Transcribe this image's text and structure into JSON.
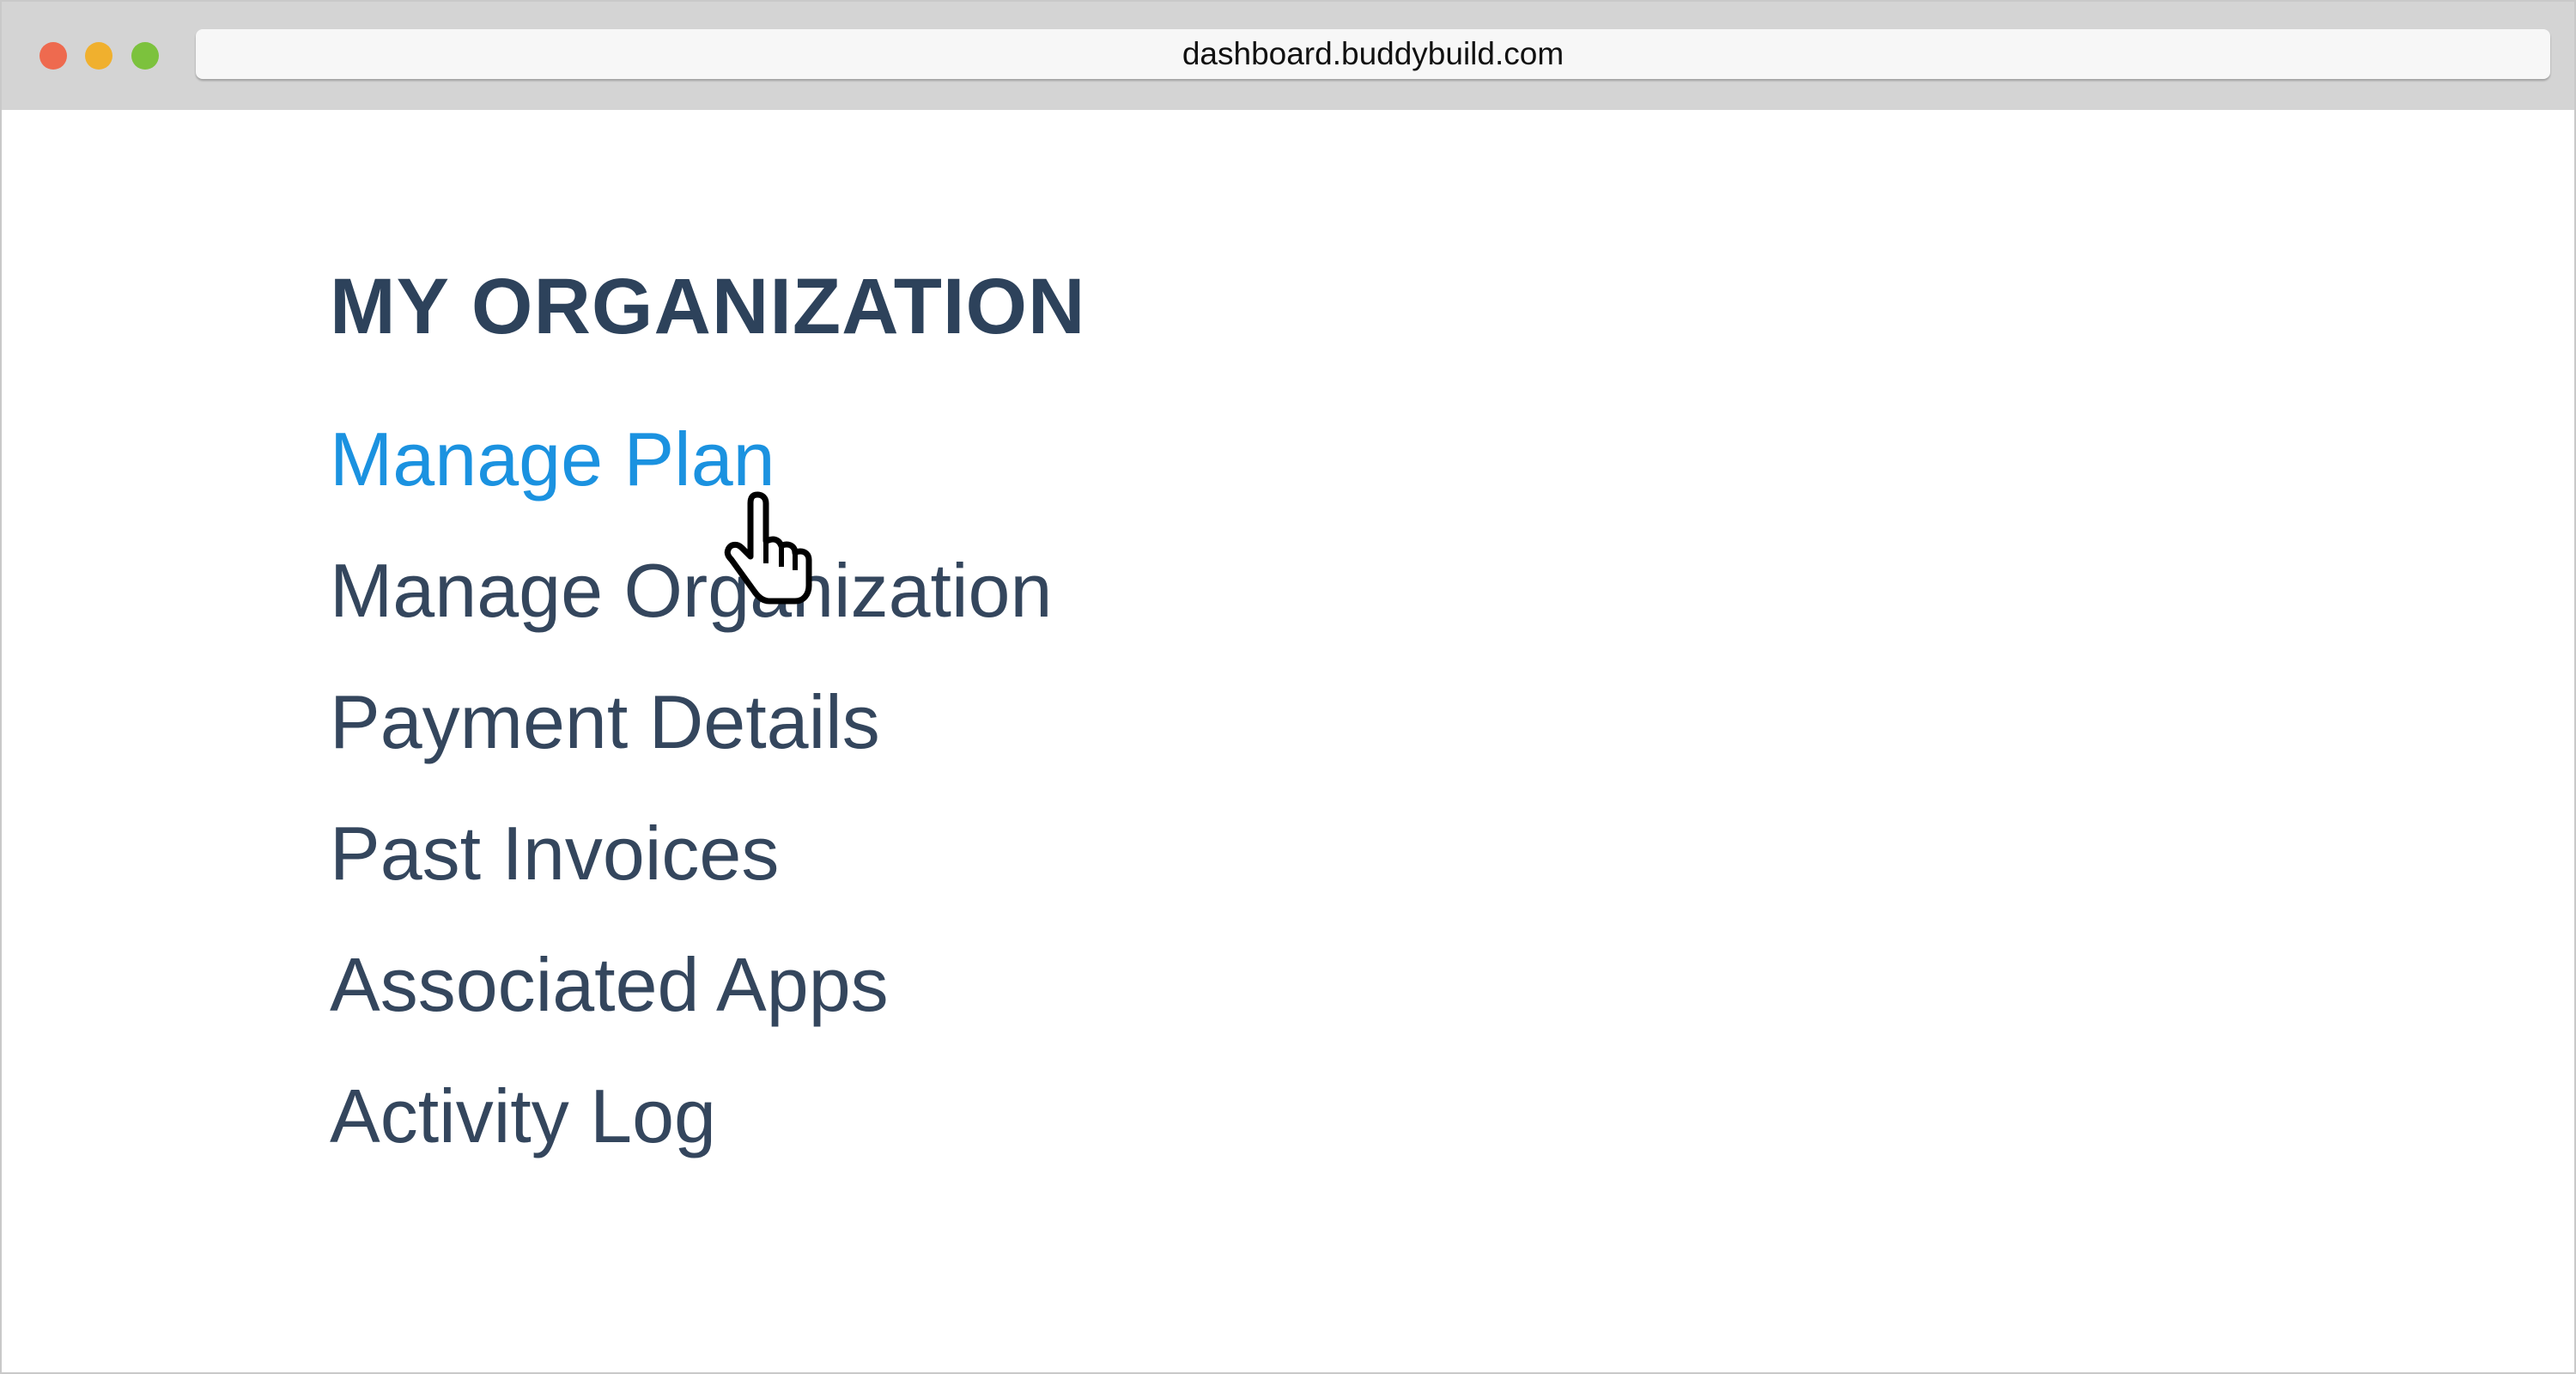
{
  "browser": {
    "url": "dashboard.buddybuild.com"
  },
  "section": {
    "title": "MY ORGANIZATION",
    "items": [
      {
        "label": "Manage Plan",
        "active": true
      },
      {
        "label": "Manage Organization",
        "active": false
      },
      {
        "label": "Payment Details",
        "active": false
      },
      {
        "label": "Past Invoices",
        "active": false
      },
      {
        "label": "Associated Apps",
        "active": false
      },
      {
        "label": "Activity Log",
        "active": false
      }
    ]
  },
  "colors": {
    "accent": "#1b92e0",
    "text": "#34465d",
    "titlebar": "#d4d4d4"
  },
  "icons": {
    "cursor": "pointer-hand-icon"
  }
}
